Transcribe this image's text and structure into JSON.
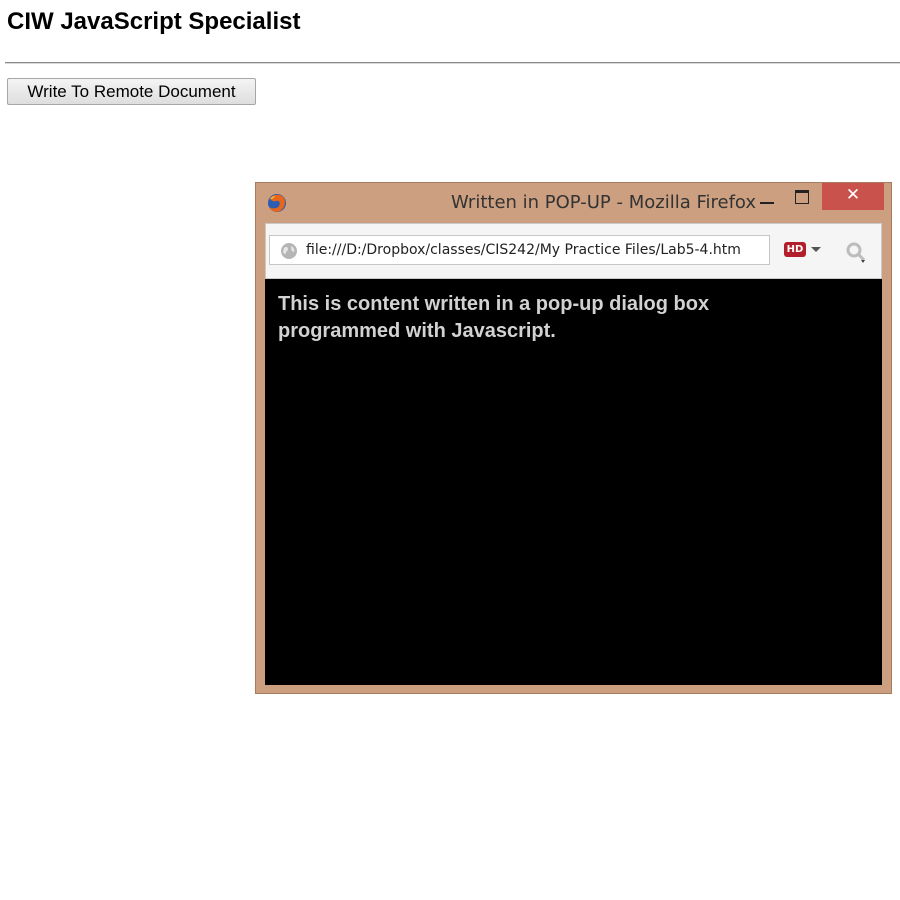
{
  "page": {
    "title": "CIW JavaScript Specialist",
    "button_label": "Write To Remote Document"
  },
  "popup": {
    "window_title": "Written in POP-UP - Mozilla Firefox",
    "close_glyph": "✕",
    "url": "file:///D:/Dropbox/classes/CIS242/My Practice Files/Lab5-4.htm",
    "hd_badge": "HD",
    "content_text": "This is content written in a pop-up dialog box programmed with Javascript."
  },
  "colors": {
    "window_frame": "#cb9f80",
    "close_button": "#c9524d",
    "content_background": "#000000",
    "content_text": "#d2d2d2",
    "hd_badge": "#b21f2b"
  },
  "icons": {
    "browser": "firefox-icon",
    "site": "globe-icon",
    "search": "search-icon"
  }
}
